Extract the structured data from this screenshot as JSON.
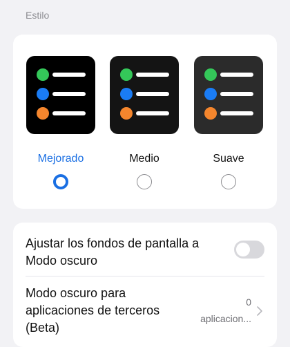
{
  "section": {
    "label": "Estilo"
  },
  "themes": [
    {
      "label": "Mejorado",
      "selected": true,
      "label_color": "#1a6fe3",
      "preview_bg": "#000000"
    },
    {
      "label": "Medio",
      "selected": false,
      "label_color": "#111111",
      "preview_bg": "#141414"
    },
    {
      "label": "Suave",
      "selected": false,
      "label_color": "#111111",
      "preview_bg": "#2b2b2b"
    }
  ],
  "preview_dots": {
    "green": "#34c759",
    "blue": "#1a7cf5",
    "orange": "#f5862d"
  },
  "settings": {
    "wallpaper_label": "Ajustar los fondos de pantalla a Modo oscuro",
    "wallpaper_toggle_on": false,
    "third_party_label": "Modo oscuro para aplicaciones de terceros (Beta)",
    "third_party_count": "0",
    "third_party_unit": "aplicacion..."
  },
  "colors": {
    "accent": "#1a6fe3",
    "background": "#f2f2f5",
    "card": "#ffffff"
  }
}
